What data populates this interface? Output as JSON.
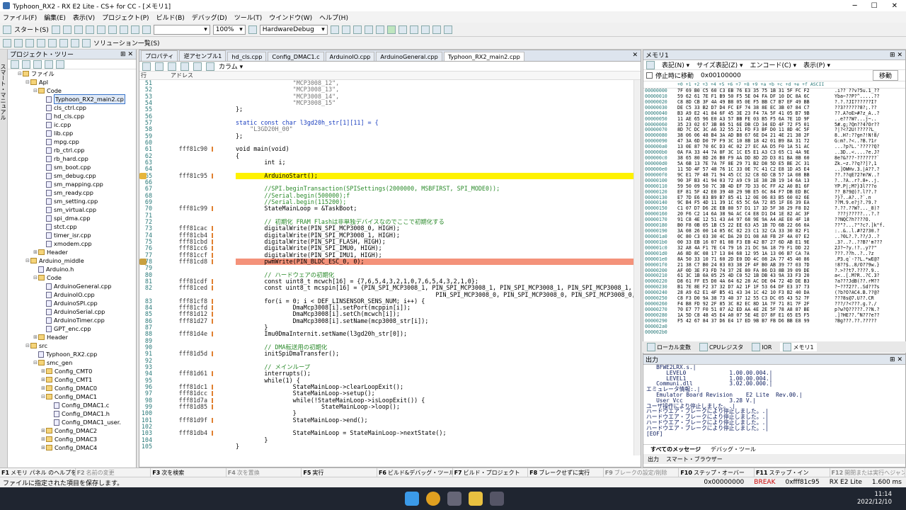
{
  "window": {
    "title": "Typhoon_RX2 - RX E2 Lite - CS+ for CC - [メモリ1]"
  },
  "menu": [
    "ファイル(F)",
    "編集(E)",
    "表示(V)",
    "プロジェクト(P)",
    "ビルド(B)",
    "デバッグ(D)",
    "ツール(T)",
    "ウインドウ(W)",
    "ヘルプ(H)"
  ],
  "toolbar": {
    "start_label": "スタート(S)",
    "zoom": "100%",
    "debug_tool": "HardwareDebug",
    "solution_label": "ソリューション一覧(S)"
  },
  "project": {
    "title": "プロジェクト・ツリー",
    "side_tab": "スマート・マニュアル",
    "items": [
      {
        "label": "ファイル",
        "depth": 2,
        "type": "folder",
        "exp": "-"
      },
      {
        "label": "Apl",
        "depth": 3,
        "type": "folder",
        "exp": "-"
      },
      {
        "label": "Code",
        "depth": 4,
        "type": "folder",
        "exp": "-"
      },
      {
        "label": "Typhoon_RX2_main2.cp",
        "depth": 5,
        "type": "file",
        "sel": true
      },
      {
        "label": "cls_ctrl.cpp",
        "depth": 5,
        "type": "file"
      },
      {
        "label": "hd_cls.cpp",
        "depth": 5,
        "type": "file"
      },
      {
        "label": "ic.cpp",
        "depth": 5,
        "type": "file"
      },
      {
        "label": "lib.cpp",
        "depth": 5,
        "type": "file"
      },
      {
        "label": "mpg.cpp",
        "depth": 5,
        "type": "file"
      },
      {
        "label": "rb_ctrl.cpp",
        "depth": 5,
        "type": "file"
      },
      {
        "label": "rb_hard.cpp",
        "depth": 5,
        "type": "file"
      },
      {
        "label": "sm_boot.cpp",
        "depth": 5,
        "type": "file"
      },
      {
        "label": "sm_debug.cpp",
        "depth": 5,
        "type": "file"
      },
      {
        "label": "sm_mapping.cpp",
        "depth": 5,
        "type": "file"
      },
      {
        "label": "sm_ready.cpp",
        "depth": 5,
        "type": "file"
      },
      {
        "label": "sm_setting.cpp",
        "depth": 5,
        "type": "file"
      },
      {
        "label": "sm_virtual.cpp",
        "depth": 5,
        "type": "file"
      },
      {
        "label": "spi_dma.cpp",
        "depth": 5,
        "type": "file"
      },
      {
        "label": "stct.cpp",
        "depth": 5,
        "type": "file"
      },
      {
        "label": "timer_isr.cpp",
        "depth": 5,
        "type": "file"
      },
      {
        "label": "xmodem.cpp",
        "depth": 5,
        "type": "file"
      },
      {
        "label": "Header",
        "depth": 4,
        "type": "folder",
        "exp": "+"
      },
      {
        "label": "Arduino_middle",
        "depth": 3,
        "type": "folder",
        "exp": "-"
      },
      {
        "label": "Arduino.h",
        "depth": 4,
        "type": "file"
      },
      {
        "label": "Code",
        "depth": 4,
        "type": "folder",
        "exp": "-"
      },
      {
        "label": "ArduinoGeneral.cpp",
        "depth": 5,
        "type": "file"
      },
      {
        "label": "ArduinoIO.cpp",
        "depth": 5,
        "type": "file"
      },
      {
        "label": "ArduinoSPI.cpp",
        "depth": 5,
        "type": "file"
      },
      {
        "label": "ArduinoSerial.cpp",
        "depth": 5,
        "type": "file"
      },
      {
        "label": "ArduinoTimer.cpp",
        "depth": 5,
        "type": "file"
      },
      {
        "label": "GPT_enc.cpp",
        "depth": 5,
        "type": "file"
      },
      {
        "label": "Header",
        "depth": 4,
        "type": "folder",
        "exp": "+"
      },
      {
        "label": "src",
        "depth": 3,
        "type": "folder",
        "exp": "-"
      },
      {
        "label": "Typhoon_RX2.cpp",
        "depth": 4,
        "type": "file"
      },
      {
        "label": "smc_gen",
        "depth": 4,
        "type": "folder",
        "exp": "-"
      },
      {
        "label": "Config_CMT0",
        "depth": 5,
        "type": "folder",
        "exp": "+"
      },
      {
        "label": "Config_CMT1",
        "depth": 5,
        "type": "folder",
        "exp": "+"
      },
      {
        "label": "Config_DMAC0",
        "depth": 5,
        "type": "folder",
        "exp": "+"
      },
      {
        "label": "Config_DMAC1",
        "depth": 5,
        "type": "folder",
        "exp": "-"
      },
      {
        "label": "Config_DMAC1.c",
        "depth": 6,
        "type": "file"
      },
      {
        "label": "Config_DMAC1.h",
        "depth": 6,
        "type": "file"
      },
      {
        "label": "Config_DMAC1_user.",
        "depth": 6,
        "type": "file"
      },
      {
        "label": "Config_DMAC2",
        "depth": 5,
        "type": "folder",
        "exp": "+"
      },
      {
        "label": "Config_DMAC3",
        "depth": 5,
        "type": "folder",
        "exp": "+"
      },
      {
        "label": "Config_DMAC4",
        "depth": 5,
        "type": "folder",
        "exp": "+"
      }
    ]
  },
  "editor": {
    "tabs": [
      "プロパティ",
      "逆アセンブル1",
      "hd_cls.cpp",
      "Config_DMAC1.c",
      "ArduinoIO.cpp",
      "ArduinoGeneral.cpp",
      "Typhoon_RX2_main2.cpp"
    ],
    "active_tab": 6,
    "column_btn": "カラム",
    "col_line": "行",
    "col_addr": "アドレス",
    "lines": [
      {
        "n": "51",
        "a": "",
        "c": "                \"MCP3008_12\",",
        "t": "str"
      },
      {
        "n": "52",
        "a": "",
        "c": "                \"MCP3008_13\",",
        "t": "str"
      },
      {
        "n": "53",
        "a": "",
        "c": "                \"MCP3008_14\",",
        "t": "str"
      },
      {
        "n": "54",
        "a": "",
        "c": "                \"MCP3008_15\"",
        "t": "str"
      },
      {
        "n": "55",
        "a": "",
        "c": "};",
        "t": ""
      },
      {
        "n": "56",
        "a": "",
        "c": "",
        "t": ""
      },
      {
        "n": "57",
        "a": "",
        "c": "static const char l3gd20h_str[1][11] = {",
        "t": "kw"
      },
      {
        "n": "58",
        "a": "",
        "c": "    \"L3GD20H_00\"",
        "t": "str"
      },
      {
        "n": "59",
        "a": "",
        "c": "};",
        "t": ""
      },
      {
        "n": "60",
        "a": "",
        "c": "",
        "t": ""
      },
      {
        "n": "61",
        "a": "fff81c90",
        "c": "void main(void)",
        "t": ""
      },
      {
        "n": "62",
        "a": "",
        "c": "{",
        "t": ""
      },
      {
        "n": "63",
        "a": "",
        "c": "        int i;",
        "t": ""
      },
      {
        "n": "64",
        "a": "",
        "c": "",
        "t": ""
      },
      {
        "n": "65",
        "a": "fff81c95",
        "c": "        ArduinoStart();",
        "t": "",
        "hl": "yel"
      },
      {
        "n": "66",
        "a": "",
        "c": "",
        "t": ""
      },
      {
        "n": "67",
        "a": "",
        "c": "        //SPI.beginTransaction(SPISettings(2000000, MSBFIRST, SPI_MODE0));",
        "t": "cmt"
      },
      {
        "n": "68",
        "a": "",
        "c": "        //Serial.begin(500000);f",
        "t": "cmt"
      },
      {
        "n": "69",
        "a": "",
        "c": "        //Serial.begin(115200);",
        "t": "cmt"
      },
      {
        "n": "70",
        "a": "fff81c99",
        "c": "        StateMainLoop = &TaskBoot;",
        "t": ""
      },
      {
        "n": "71",
        "a": "",
        "c": "",
        "t": ""
      },
      {
        "n": "72",
        "a": "",
        "c": "        // 初期化 FRAM Flashは非単独デバイスなのでここで初期化する",
        "t": "cmt"
      },
      {
        "n": "73",
        "a": "fff81cac",
        "c": "        digitalWrite(PIN_SPI_MCP3008_0, HIGH);",
        "t": ""
      },
      {
        "n": "74",
        "a": "fff81cb4",
        "c": "        digitalWrite(PIN_SPI_MCP3008_1, HIGH);",
        "t": ""
      },
      {
        "n": "75",
        "a": "fff81cbd",
        "c": "        digitalWrite(PIN_SPI_FLASH, HIGH);",
        "t": ""
      },
      {
        "n": "76",
        "a": "fff81cc6",
        "c": "        digitalWrite(PIN_SPI_IMU0, HIGH);",
        "t": ""
      },
      {
        "n": "77",
        "a": "fff81ccf",
        "c": "        digitalWrite(PIN_SPI_IMU1, HIGH);",
        "t": ""
      },
      {
        "n": "78",
        "a": "fff81cd8",
        "c": "        pwmWrite(PIN_BLDC_ESC_0, 0);",
        "t": "",
        "hl": "red"
      },
      {
        "n": "79",
        "a": "",
        "c": "",
        "t": ""
      },
      {
        "n": "80",
        "a": "",
        "c": "        // ハードウェアの初期化",
        "t": "cmt"
      },
      {
        "n": "81",
        "a": "fff81cdf",
        "c": "        const uint8_t mcwch[16] = {7,6,5,4,3,2,1,0,7,6,5,4,3,2,1,0};",
        "t": ""
      },
      {
        "n": "82",
        "a": "fff81ced",
        "c": "        const uint8_t mcspin[16] = {PIN_SPI_MCP3008_1, PIN_SPI_MCP3008_1, PIN_SPI_MCP3008_1, PIN_SPI_MCP3008_1, PI",
        "t": ""
      },
      {
        "n": "",
        "a": "",
        "c": "                                                        PIN_SPI_MCP3008_0, PIN_SPI_MCP3008_0, PIN_SPI_MCP3008_0, PIN_SPI_MCP3",
        "t": ""
      },
      {
        "n": "83",
        "a": "fff81cf8",
        "c": "        for(i = 0; i < DEF_LINSENSOR_SENS_NUM; i++) {",
        "t": ""
      },
      {
        "n": "84",
        "a": "fff81cfd",
        "c": "                DmaMcp3008[i].setPort(mcppin[i]);",
        "t": ""
      },
      {
        "n": "85",
        "a": "fff81d12",
        "c": "                DmaMcp3008[i].setCh(mcwch[i]);",
        "t": ""
      },
      {
        "n": "86",
        "a": "fff81d27",
        "c": "                DmaMcp3008[i].setName(mcp3008_str[i]);",
        "t": ""
      },
      {
        "n": "87",
        "a": "",
        "c": "        }",
        "t": ""
      },
      {
        "n": "88",
        "a": "fff81d4e",
        "c": "        Imu0DmaInternit.setName(l3gd20h_str[0]);",
        "t": ""
      },
      {
        "n": "89",
        "a": "",
        "c": "",
        "t": ""
      },
      {
        "n": "90",
        "a": "",
        "c": "        // DMA転送用の初期化",
        "t": "cmt"
      },
      {
        "n": "91",
        "a": "fff81d5d",
        "c": "        initSpiDmaTransfer();",
        "t": ""
      },
      {
        "n": "92",
        "a": "",
        "c": "",
        "t": ""
      },
      {
        "n": "93",
        "a": "",
        "c": "        // メインループ",
        "t": "cmt"
      },
      {
        "n": "94",
        "a": "fff81d61",
        "c": "        interrupts();",
        "t": ""
      },
      {
        "n": "95",
        "a": "",
        "c": "        while(1) {",
        "t": ""
      },
      {
        "n": "96",
        "a": "fff81dc1",
        "c": "                StateMainLoop->clearLoopExit();",
        "t": ""
      },
      {
        "n": "97",
        "a": "fff81dcc",
        "c": "                StateMainLoop->setup();",
        "t": ""
      },
      {
        "n": "98",
        "a": "fff81d7a",
        "c": "                while(!StateMainLoop->isLoopExit()) {",
        "t": ""
      },
      {
        "n": "99",
        "a": "fff81d85",
        "c": "                        StateMainLoop->loop();",
        "t": ""
      },
      {
        "n": "100",
        "a": "",
        "c": "                }",
        "t": ""
      },
      {
        "n": "101",
        "a": "fff81d9f",
        "c": "                StateMainLoop->end();",
        "t": ""
      },
      {
        "n": "102",
        "a": "",
        "c": "",
        "t": ""
      },
      {
        "n": "103",
        "a": "fff81db4",
        "c": "                StateMainLoop = StateMainLoop->nextState();",
        "t": ""
      },
      {
        "n": "104",
        "a": "",
        "c": "        }",
        "t": ""
      },
      {
        "n": "105",
        "a": "",
        "c": "}",
        "t": ""
      }
    ]
  },
  "memory": {
    "title": "メモリ1",
    "menus": [
      "表記(N)",
      "サイズ表記(Z)",
      "エンコード(C)",
      "表示(P)"
    ],
    "stop_label": "停止時に移動",
    "address": "0x00100000",
    "move_btn": "移動",
    "header": "+0 +1 +2 +3 +4 +5 +6 +7 +8 +9 +a +b +c +d +e +f      ASCII",
    "addresses": [
      "00000000",
      "00000010",
      "00000020",
      "00000030",
      "00000040",
      "00000050",
      "00000060",
      "00000070",
      "00000080",
      "00000090",
      "000000a0",
      "000000b0",
      "000000c0",
      "000000d0",
      "000000e0",
      "000000f0",
      "00000100",
      "00000110",
      "00000120",
      "00000130",
      "00000140",
      "00000150",
      "00000160",
      "00000170",
      "00000180",
      "00000190",
      "000001a0",
      "000001b0",
      "000001c0",
      "000001d0",
      "000001e0",
      "000001f0",
      "00000200",
      "00000210",
      "00000220",
      "00000230",
      "00000240",
      "00000250",
      "00000260",
      "00000270",
      "00000280",
      "00000290",
      "000002a0",
      "000002b0"
    ],
    "hex": [
      "7F 69 B0 C5 60 C3 EB 76 E3 35 75 1B 31 5F FC F2",
      "59 62 61 7E F1 B9 50 F5 5E 04 FA DF 10 DC 8A 6C",
      "C8 8D CB 3F 4A 49 B8 05 0E F5 BB C7 B7 EF 49 BB",
      "DE C5 33 B2 D7 D4 FC EF 74 38 8E EC 3B 07 84 C7",
      "B3 A9 E2 41 84 6F 45 3E 23 F4 7A 5F 41 05 B7 9B",
      "11 AE 65 96 E0 A3 57 BB FE 03 B5 F5 6A 7E 1D 9F",
      "35 23 02 67 3B 86 51 6E DB CD 34 ED 4F 72 F5 01",
      "8D 7C DC 3C A6 32 55 21 FD F3 BF D0 11 8D 4C 5F",
      "38 06 06 48 B4 3A AD B8 67 6E D4 21 4E 21 38 2F",
      "47 3A 6D D0 7F F9 3C 10 8B 18 42 01 B9 8A 31 72",
      "13 0E 87 70 6C D3 4C 02 27 EC AA D5 F0 1A 51 AC",
      "0A FA 33 44 7A 8F 3C 1C E5 E1 A3 C3 65 C1 4A 9E",
      "38 65 80 8D 26 B0 F9 AA DD 8D 2D D3 81 BA 8B 60",
      "5A 6B 13 7E 7A 7F 8E 29 71 B2 D8 5D E5 BE 2C 31",
      "11 5D 4F 57 48 76 1C 33 0E 7C 41 C2 E8 1D A5 E4",
      "9C E1 7F 48 71 94 45 CC 32 C8 6D CB 57 1A 08 BB",
      "90 3F B3 41 94 03 72 A9 C9 1E 38 2B 19 14 6A 13",
      "59 50 09 50 7C 3B 4D EF 7D 33 6C FF A2 A0 B1 6F",
      "EF 81 5F 42 E0 39 40 29 9B E5 6C 84 F7 DB ED BC",
      "E7 7D E6 83 B9 B7 85 41 12 0E 06 83 B5 60 02 6E",
      "9C B4 F5 4D 11 39 1C 65 5C 6A 72 85 1F E6 39 EA",
      "C1 07 D7 D6 2E EB 80 57 D1 17 1D 5F 38 29 F8 D2",
      "20 F6 C2 14 6A 38 9A AC C4 E8 D1 D4 1E 82 AC 3F",
      "91 C8 4E 12 51 43 A4 97 68 9E 9A A4 AE E0 4F 18",
      "B0 F8 0B 05 1B C5 22 EE 63 A5 1B 7D 6B 22 66 0A",
      "3A 08 26 00 14 05 6C 02 23 C1 32 CA 33 30 82 F1",
      "0C 80 C3 03 30 4C DA 20 D1 08 A8 FB 2F 4A 07 E2",
      "00 33 EB 16 07 01 08 F3 EB 42 B7 27 6D AB E1 9E",
      "32 A8 4A F1 7E C4 79 16 21 DC 9A 18 79 F1 DD 22",
      "A6 8D 8C 08 17 13 84 68 12 95 1A 13 06 B7 CA 7A",
      "8A 50 33 10 71 60 2D E0 DD 4C 08 2A 77 45 40 86",
      "21 38 C7 B0 24 03 03 38 2F 4F B0 AB 39 77 03 7D",
      "AF 0D 3E F3 FD 74 37 2E 80 FA 86 D3 8B 39 09 DE",
      "61 3C 1B 0A 05 25 4D C0 52 1B DB 43 9A 33 F3 20",
      "D8 61 FF E5 D0 4A 64 62 28 AC DE 04 72 4D DE B3",
      "B1 7E 8E F2 37 32 D7 A2 1F 1F 53 64 DF E3 37 73",
      "28 A9 62 E1 4F B5 41 43 34 1C 42 10 F3 B2 40 DA",
      "C8 F3 D0 9A 38 73 40 37 12 55 C3 DC 05 43 52 7F",
      "F4 B8 FD 92 2F 85 3C 82 EC 8D 1A 7F 71 81 7F 2F",
      "70 E7 77 F0 51 07 A2 ED AA 4E 2E 5F 78 A8 87 BE",
      "1A 5D C8 48 45 E4 A0 07 5E 4E D7 8F E1 65 E5 F5",
      "F5 42 67 84 37 D6 E4 17 ED 9B B7 FB D6 BB E8 99"
    ],
    "ascii": [
      ".i??`??v?5u.1_??",
      "Yba~??P?^.....??",
      "?.?.?JI??????I?",
      "??3??????8?;.??",
      "??.A?oE>#?z_A..?",
      "..e???W?...j~..",
      "5#.g;?Qn??4?Or??",
      "?|?<?2U!?????L_",
      "8..H?:??gn?!N!8/",
      "G:m?.?<..?B.?1r",
      "...?p?L.'?????Q?",
      "..3D..<....?e.J?",
      "8e?&???-???????`",
      "Zk.~z.??q??]?,1",
      "..]OWHv.3.|A??.?",
      "??.??qE?2?m?W..?",
      "?..?A..r?.8+..j.",
      "YP.P|;M?}3l???o",
      "??_B?9@)?.l??.?",
      "?}?..A?..?`.n",
      "??M.9.e?j?.?9.?",
      "?.??.??W?..._8)?",
      " ???j?????...?.?",
      "??NQC?h????O.",
      "??\"?...?\"?c?.]k\"f.",
      ":..&..l.#?2?30.?",
      "..?0L?.?.??/J..?",
      ".3?..?..??B?'m???",
      "2J?~?y.!?..y??\"",
      "???.??h..?..?z",
      ".P3.q`-??L.*wE@?",
      "!8??$..8/O??9w.}",
      "?.>??t7.????.9..",
      "a<..[.M?R..?C.3?",
      "?a???JdB(??.rM??",
      "?~??72??..Sd??7s",
      "(?b?O?AC4.B.??@?",
      "???8s@7.U??.CR",
      "???/?<???.g.?./",
      "p?w?Q?????.??N.?",
      ".]?HE??.^N???e??",
      "?Bg???.??.?????"
    ],
    "bottom_tabs": [
      "ローカル変数",
      "CPUレジスタ",
      "IOR",
      "メモリ1"
    ]
  },
  "output": {
    "title": "出力",
    "lines": [
      "   BFWE2LRX.s.|",
      "      LEVEL0             1.00.00.004.|",
      "      LEVEL1             1.00.00.004.|",
      "   Communi.dll           3.02.00.000.|",
      "エミュレータ情報:.|",
      "   Emulator Board Revision    E2 Lite  Rev.00.|",
      "   User Vcc              3.28 V.|",
      "ユーザ操作により停止しました。.|",
      "ハードウエア・ブレークにより停止しました。.|",
      "ハードウエア・ブレークにより停止しました。.|",
      "ハードウエア・ブレークにより停止しました。.|",
      "ハードウエア・ブレークにより停止しました。.|",
      "[EOF]"
    ],
    "tabs": [
      "すべてのメッセージ",
      "デバッグ・ツール"
    ],
    "bottom": [
      "出力",
      "スマート・ブラウザー"
    ]
  },
  "fkeys": [
    {
      "k": "F1",
      "t": "メモリ パネル のヘルプを開く",
      "dis": false
    },
    {
      "k": "F2",
      "t": "名前の変更",
      "dis": true
    },
    {
      "k": "F3",
      "t": "次を検索",
      "dis": false
    },
    {
      "k": "F4",
      "t": "次を置換",
      "dis": true
    },
    {
      "k": "F5",
      "t": "実行",
      "dis": false
    },
    {
      "k": "F6",
      "t": "ビルド&デバッグ・ツールへ…",
      "dis": false
    },
    {
      "k": "F7",
      "t": "ビルド・プロジェクト",
      "dis": false
    },
    {
      "k": "F8",
      "t": "ブレークせずに実行",
      "dis": false
    },
    {
      "k": "F9",
      "t": "ブレークの設定/削除",
      "dis": true
    },
    {
      "k": "F10",
      "t": "ステップ・オーバー",
      "dis": false
    },
    {
      "k": "F11",
      "t": "ステップ・イン",
      "dis": false
    },
    {
      "k": "F12",
      "t": "開閉または実行へジャンプ",
      "dis": true
    }
  ],
  "status": {
    "message": "ファイルに指定された項目を保存します。",
    "pc": "0x00000000",
    "state": "BREAK",
    "addr": "0xfff81c95",
    "target": "RX E2 Lite",
    "time": "1.600 ms"
  },
  "taskbar": {
    "time": "11:14",
    "date": "2022/12/10"
  }
}
